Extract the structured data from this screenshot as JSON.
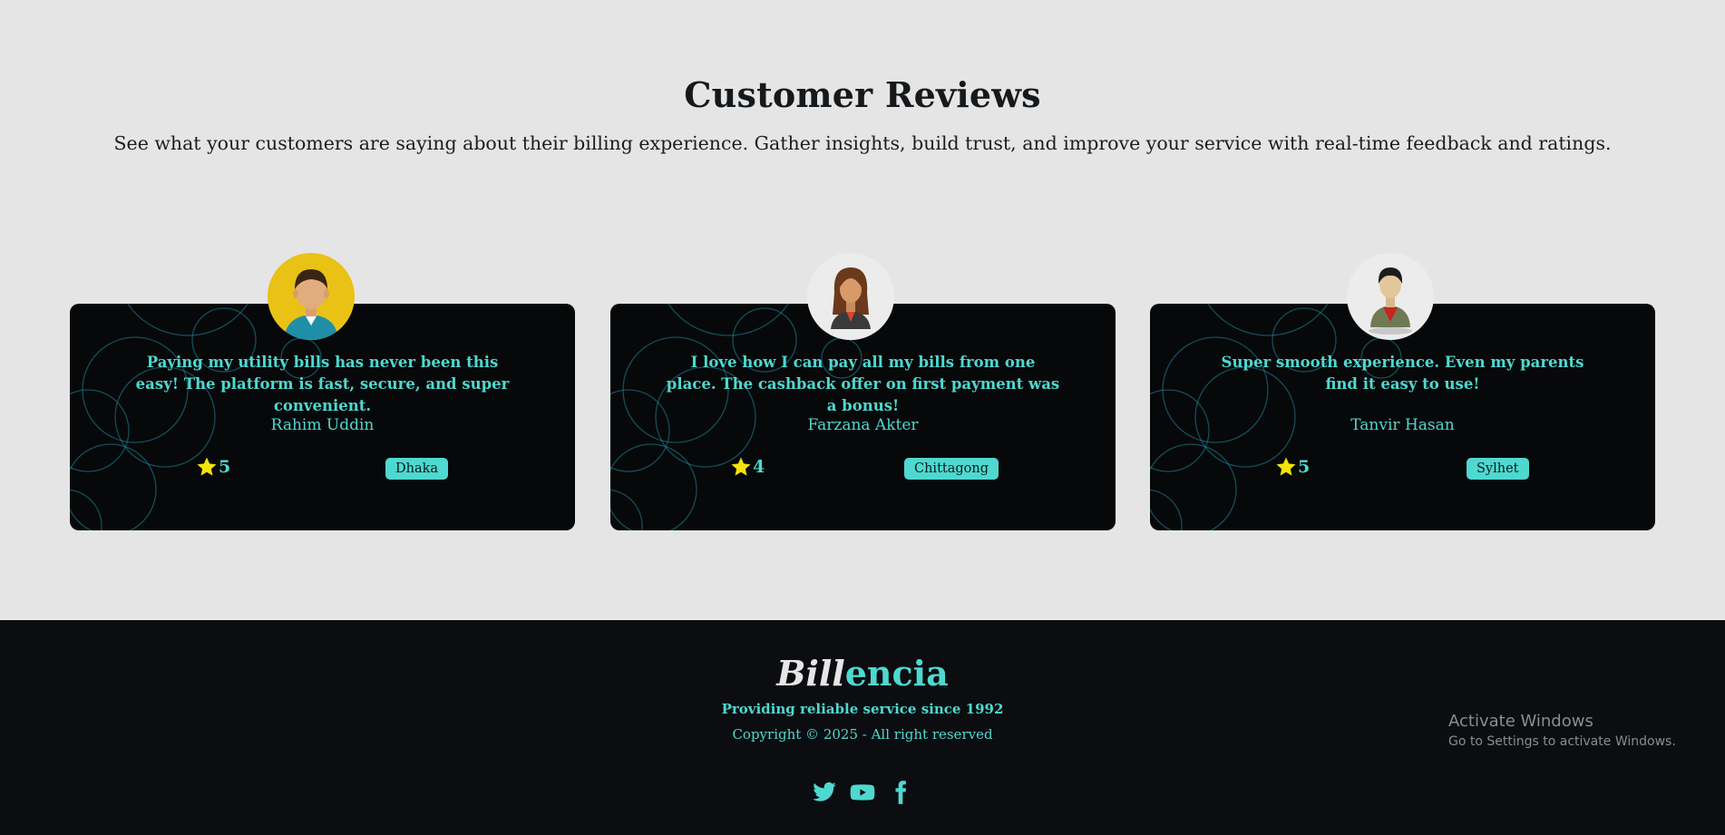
{
  "section": {
    "title": "Customer Reviews",
    "subtitle": "See what your customers are saying about their billing experience. Gather insights, build trust, and improve your service with real-time feedback and ratings."
  },
  "reviews": [
    {
      "quote": "Paying my utility bills has never been this easy! The platform is fast, secure, and super convenient.",
      "name": "Rahim Uddin",
      "rating": "5",
      "city": "Dhaka",
      "avatar": "man-avatar-icon"
    },
    {
      "quote": "I love how I can pay all my bills from one place. The cashback offer on first payment was a bonus!",
      "name": "Farzana Akter",
      "rating": "4",
      "city": "Chittagong",
      "avatar": "woman-avatar-icon"
    },
    {
      "quote": "Super smooth experience. Even my parents find it easy to use!",
      "name": "Tanvir Hasan",
      "rating": "5",
      "city": "Sylhet",
      "avatar": "young-man-avatar-icon"
    }
  ],
  "footer": {
    "brand_part1": "Bill",
    "brand_part2": "encia",
    "tagline": "Providing reliable service since 1992",
    "copyright": "Copyright © 2025 - All right reserved",
    "socials": [
      "twitter-icon",
      "youtube-icon",
      "facebook-icon"
    ]
  },
  "watermark": {
    "line1": "Activate Windows",
    "line2": "Go to Settings to activate Windows."
  },
  "colors": {
    "accent": "#4fd8d0",
    "card_bg": "#070809",
    "page_bg": "#e5e5e5",
    "footer_bg": "#0b0d10",
    "star": "#f4e20c"
  }
}
